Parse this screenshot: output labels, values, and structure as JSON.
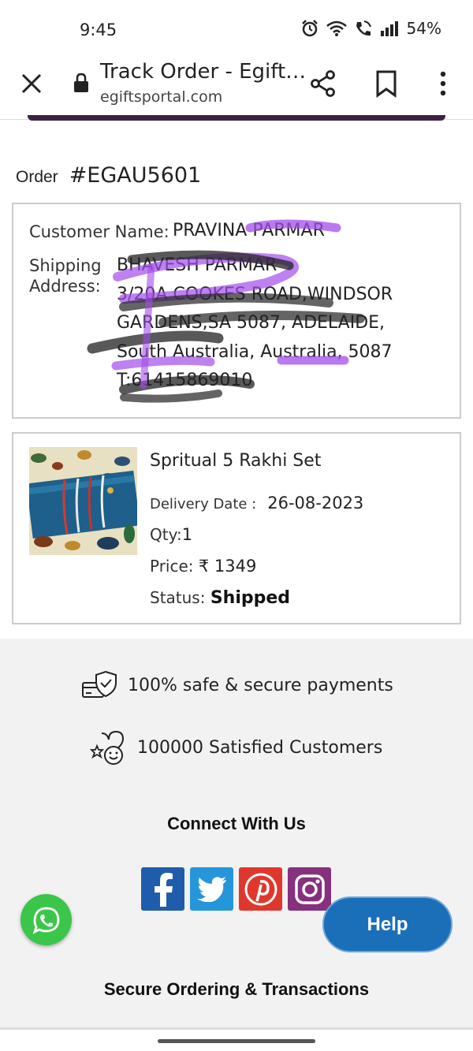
{
  "status_bar": {
    "time": "9:45",
    "battery": "54%",
    "icons": [
      "alarm-icon",
      "wifi-icon",
      "wifi-call-icon",
      "signal-icon"
    ]
  },
  "browser": {
    "title": "Track Order - Egift…",
    "url": "egiftsportal.com",
    "icons": [
      "close-icon",
      "lock-icon",
      "share-icon",
      "bookmark-icon",
      "more-icon"
    ]
  },
  "order": {
    "label": "Order",
    "number": "#EGAU5601"
  },
  "customer": {
    "name_label": "Customer Name:",
    "name_value": "PRAVINA PARMAR",
    "address_label_1": "Shipping",
    "address_label_2": "Address:",
    "address_lines": [
      "BHAVESH PARMAR",
      "3/20A COOKES ROAD,WINDSOR",
      "GARDENS,SA 5087, ADELAIDE,",
      "South Australia, Australia, 5087",
      "T:61415869010"
    ]
  },
  "product": {
    "name": "Spritual 5 Rakhi Set",
    "delivery_label": "Delivery Date :",
    "delivery_value": "26-08-2023",
    "qty_label": "Qty:",
    "qty_value": "1",
    "price_label": "Price:",
    "price_value": "₹ 1349",
    "status_label": "Status:",
    "status_value": "Shipped"
  },
  "footer": {
    "secure_payments": "100% safe & secure payments",
    "satisfied_customers": "100000 Satisfied Customers",
    "connect_title": "Connect With Us",
    "socials": [
      "facebook-icon",
      "twitter-icon",
      "pinterest-icon",
      "instagram-icon"
    ],
    "secure_ordering": "Secure Ordering & Transactions"
  },
  "widgets": {
    "help_label": "Help",
    "whatsapp_icon": "whatsapp-icon"
  },
  "colors": {
    "facebook": "#1f5cab",
    "twitter": "#2596d9",
    "pinterest": "#e0372d",
    "instagram": "#87307d",
    "help_button": "#1b6fb8",
    "whatsapp": "#3bc64a"
  }
}
